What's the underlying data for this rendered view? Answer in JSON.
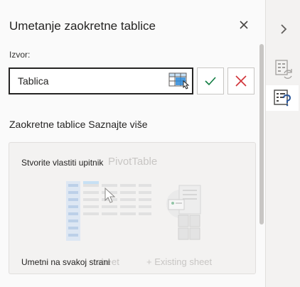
{
  "pane": {
    "title": "Umetanje zaokretne tablice",
    "close_icon": "close-icon"
  },
  "source": {
    "label": "Izvor:",
    "value": "Tablica",
    "range_picker_icon": "table-select-icon",
    "ok_icon": "checkmark-icon",
    "cancel_icon": "x-icon"
  },
  "section": {
    "heading": "Zaokretne tablice Saznajte više"
  },
  "card": {
    "title": "Stvorite vlastiti upitnik",
    "ghost_title": "PivotTable",
    "new_sheet_label": "Umetni na svakoj strani",
    "ghost_new_sheet": "sheet",
    "ghost_existing_sheet": "+ Existing sheet"
  },
  "rail": {
    "collapse_icon": "chevron-right-icon",
    "button1_icon": "data-refresh-icon",
    "button2_icon": "help-list-icon"
  },
  "colors": {
    "accent_green": "#107c41",
    "cancel_red": "#d13438",
    "picker_blue": "#2b88d8",
    "text": "#252423"
  }
}
